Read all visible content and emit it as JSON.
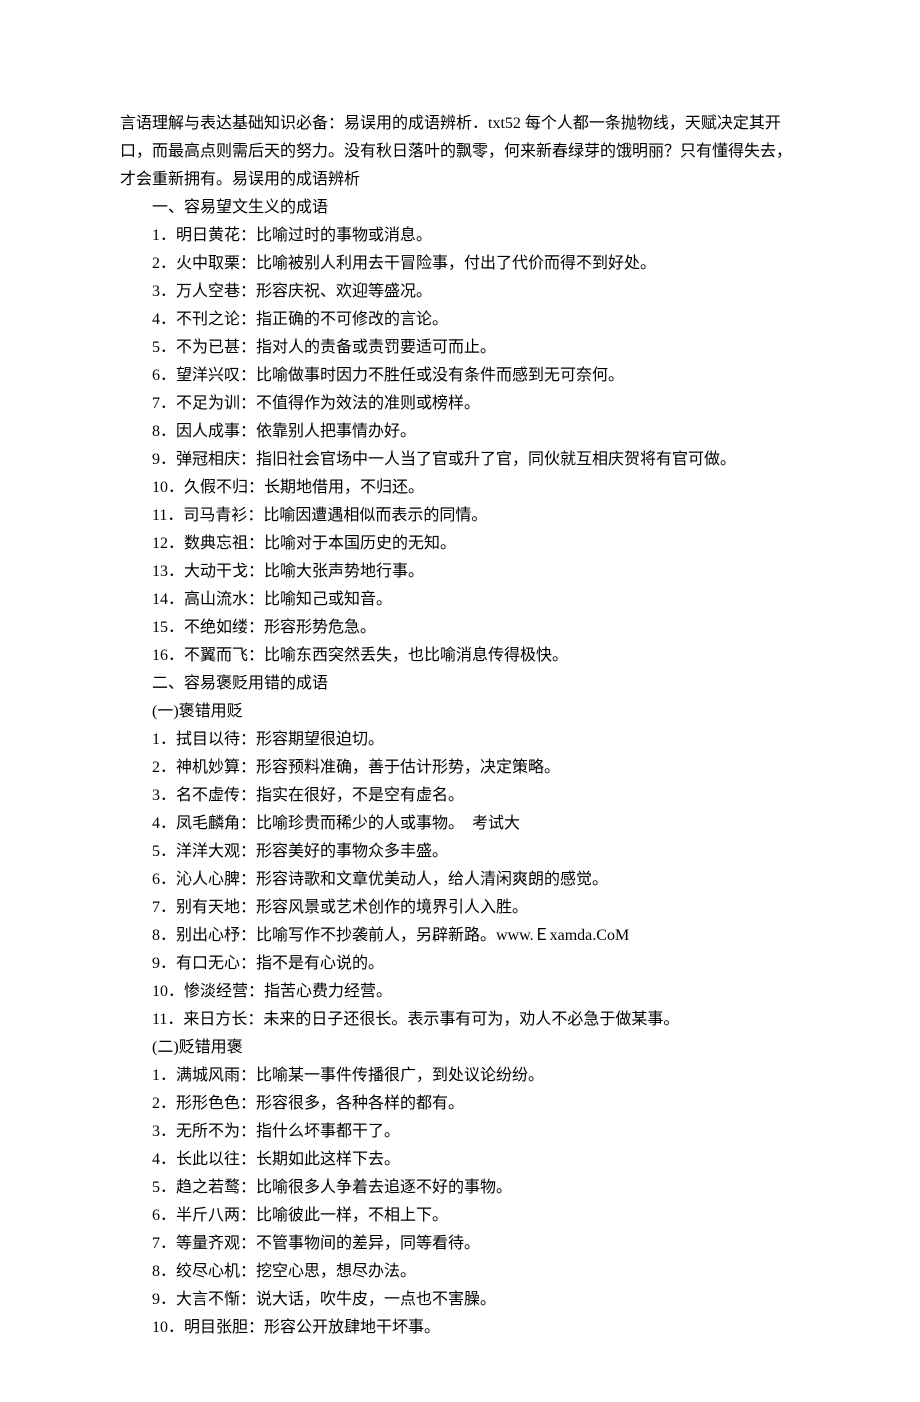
{
  "intro": "言语理解与表达基础知识必备：易误用的成语辨析．txt52 每个人都一条抛物线，天赋决定其开口，而最高点则需后天的努力。没有秋日落叶的飘零，何来新春绿芽的饿明丽？只有懂得失去，才会重新拥有。易误用的成语辨析",
  "section1": {
    "heading": "一、容易望文生义的成语",
    "items": [
      "1．明日黄花：比喻过时的事物或消息。",
      "2．火中取栗：比喻被别人利用去干冒险事，付出了代价而得不到好处。",
      "3．万人空巷：形容庆祝、欢迎等盛况。",
      "4．不刊之论：指正确的不可修改的言论。",
      "5．不为已甚：指对人的责备或责罚要适可而止。",
      "6．望洋兴叹：比喻做事时因力不胜任或没有条件而感到无可奈何。",
      "7．不足为训：不值得作为效法的准则或榜样。",
      "8．因人成事：依靠别人把事情办好。",
      "9．弹冠相庆：指旧社会官场中一人当了官或升了官，同伙就互相庆贺将有官可做。",
      "10．久假不归：长期地借用，不归还。",
      "11．司马青衫：比喻因遭遇相似而表示的同情。",
      "12．数典忘祖：比喻对于本国历史的无知。",
      "13．大动干戈：比喻大张声势地行事。",
      "14．高山流水：比喻知己或知音。",
      "15．不绝如缕：形容形势危急。",
      "16．不翼而飞：比喻东西突然丢失，也比喻消息传得极快。"
    ]
  },
  "section2": {
    "heading": "二、容易褒贬用错的成语",
    "sub1": {
      "heading": "(一)褒错用贬",
      "items": [
        "1．拭目以待：形容期望很迫切。",
        "2．神机妙算：形容预料准确，善于估计形势，决定策略。",
        "3．名不虚传：指实在很好，不是空有虚名。",
        "4．凤毛麟角：比喻珍贵而稀少的人或事物。　考试大",
        "5．洋洋大观：形容美好的事物众多丰盛。",
        "6．沁人心脾：形容诗歌和文章优美动人，给人清闲爽朗的感觉。",
        "7．别有天地：形容风景或艺术创作的境界引人入胜。",
        "8．别出心杼：比喻写作不抄袭前人，另辟新路。www.Ｅxamda.CoM",
        "9．有口无心：指不是有心说的。",
        "10．惨淡经营：指苦心费力经营。",
        "11．来日方长：未来的日子还很长。表示事有可为，劝人不必急于做某事。"
      ]
    },
    "sub2": {
      "heading": "(二)贬错用褒",
      "items": [
        "1．满城风雨：比喻某一事件传播很广，到处议论纷纷。",
        "2．形形色色：形容很多，各种各样的都有。",
        "3．无所不为：指什么坏事都干了。",
        "4．长此以往：长期如此这样下去。",
        "5．趋之若鹜：比喻很多人争着去追逐不好的事物。",
        "6．半斤八两：比喻彼此一样，不相上下。",
        "7．等量齐观：不管事物间的差异，同等看待。",
        "8．绞尽心机：挖空心思，想尽办法。",
        "9．大言不惭：说大话，吹牛皮，一点也不害臊。",
        "10．明目张胆：形容公开放肆地干坏事。"
      ]
    }
  }
}
